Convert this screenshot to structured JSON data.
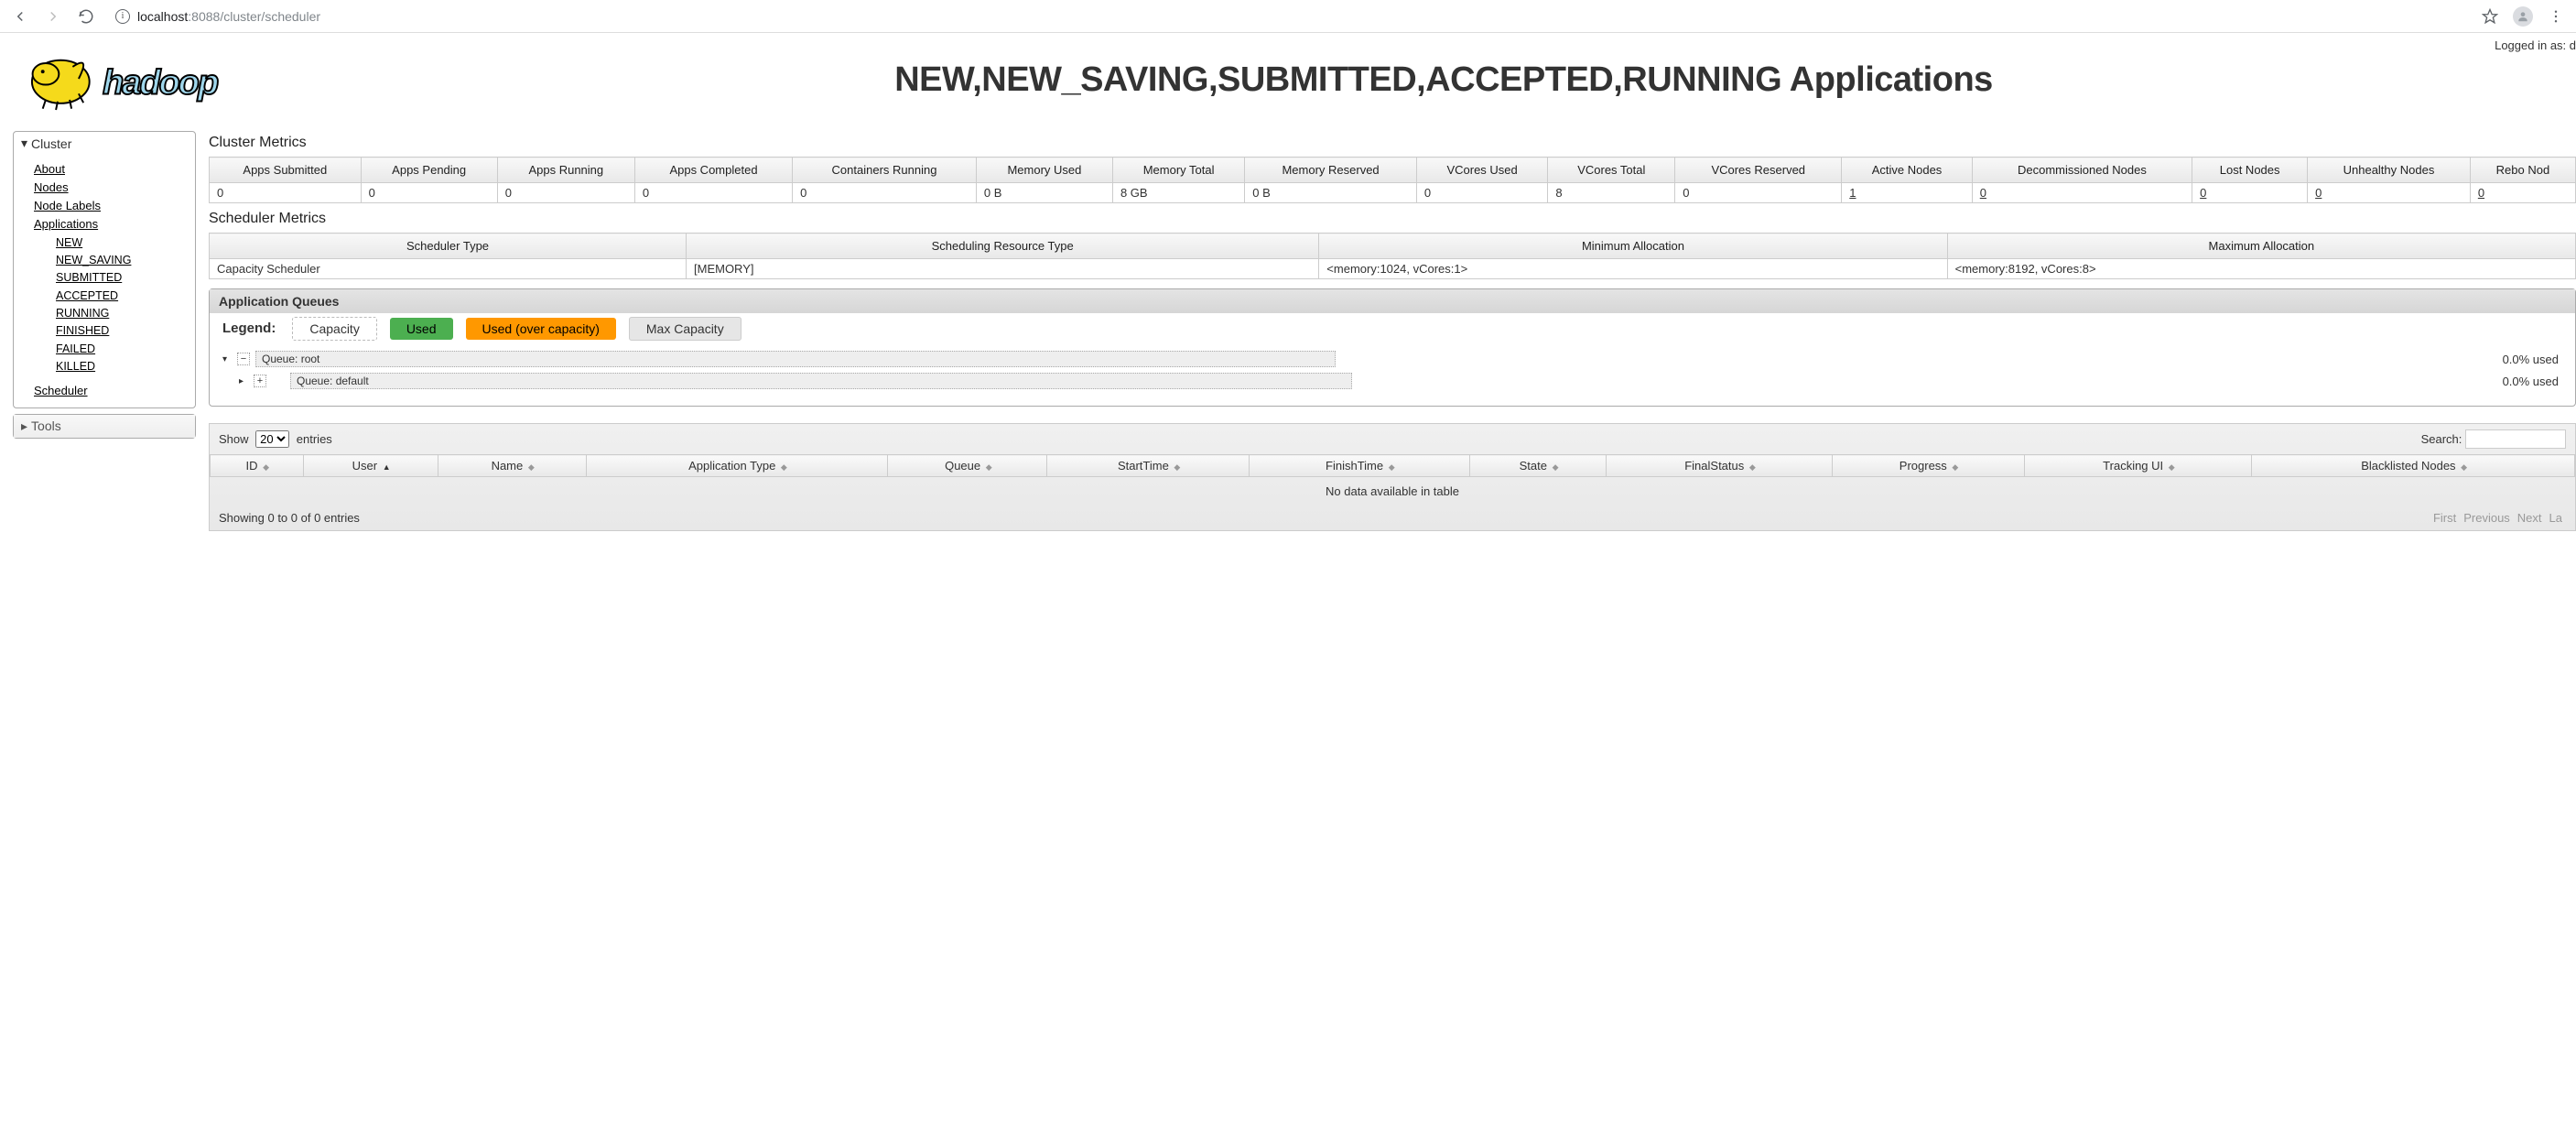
{
  "browser": {
    "host": "localhost",
    "port": ":8088",
    "path": "/cluster/scheduler"
  },
  "login_text": "Logged in as: d",
  "main_title": "NEW,NEW_SAVING,SUBMITTED,ACCEPTED,RUNNING Applications",
  "sidebar": {
    "cluster": {
      "title": "Cluster",
      "links": [
        "About",
        "Nodes",
        "Node Labels",
        "Applications"
      ],
      "sub": [
        "NEW",
        "NEW_SAVING",
        "SUBMITTED",
        "ACCEPTED",
        "RUNNING",
        "FINISHED",
        "FAILED",
        "KILLED"
      ],
      "scheduler": "Scheduler"
    },
    "tools": {
      "title": "Tools"
    }
  },
  "sections": {
    "cluster_metrics": "Cluster Metrics",
    "scheduler_metrics": "Scheduler Metrics",
    "app_queues": "Application Queues"
  },
  "cluster_metrics": {
    "headers": [
      "Apps Submitted",
      "Apps Pending",
      "Apps Running",
      "Apps Completed",
      "Containers Running",
      "Memory Used",
      "Memory Total",
      "Memory Reserved",
      "VCores Used",
      "VCores Total",
      "VCores Reserved",
      "Active Nodes",
      "Decommissioned Nodes",
      "Lost Nodes",
      "Unhealthy Nodes",
      "Rebo Nod"
    ],
    "values": [
      "0",
      "0",
      "0",
      "0",
      "0",
      "0 B",
      "8 GB",
      "0 B",
      "0",
      "8",
      "0",
      "1",
      "0",
      "0",
      "0",
      "0"
    ],
    "link_cols": [
      11,
      12,
      13,
      14,
      15
    ]
  },
  "scheduler_metrics": {
    "headers": [
      "Scheduler Type",
      "Scheduling Resource Type",
      "Minimum Allocation",
      "Maximum Allocation"
    ],
    "values": [
      "Capacity Scheduler",
      "[MEMORY]",
      "<memory:1024, vCores:1>",
      "<memory:8192, vCores:8>"
    ]
  },
  "legend": {
    "label": "Legend:",
    "items": [
      {
        "label": "Capacity",
        "cls": "chip-capacity"
      },
      {
        "label": "Used",
        "cls": "chip-used"
      },
      {
        "label": "Used (over capacity)",
        "cls": "chip-over"
      },
      {
        "label": "Max Capacity",
        "cls": "chip-max"
      }
    ]
  },
  "queues": [
    {
      "name": "root",
      "label": "Queue: root",
      "used": "0.0% used",
      "icon": "−",
      "indent": 0
    },
    {
      "name": "default",
      "label": "Queue: default",
      "used": "0.0% used",
      "icon": "+",
      "indent": 1
    }
  ],
  "apps": {
    "show_label_pre": "Show",
    "show_label_post": "entries",
    "page_size": "20",
    "search_label": "Search:",
    "headers": [
      "ID",
      "User",
      "Name",
      "Application Type",
      "Queue",
      "StartTime",
      "FinishTime",
      "State",
      "FinalStatus",
      "Progress",
      "Tracking UI",
      "Blacklisted Nodes"
    ],
    "empty": "No data available in table",
    "footer": "Showing 0 to 0 of 0 entries",
    "pager": [
      "First",
      "Previous",
      "Next",
      "La"
    ]
  }
}
